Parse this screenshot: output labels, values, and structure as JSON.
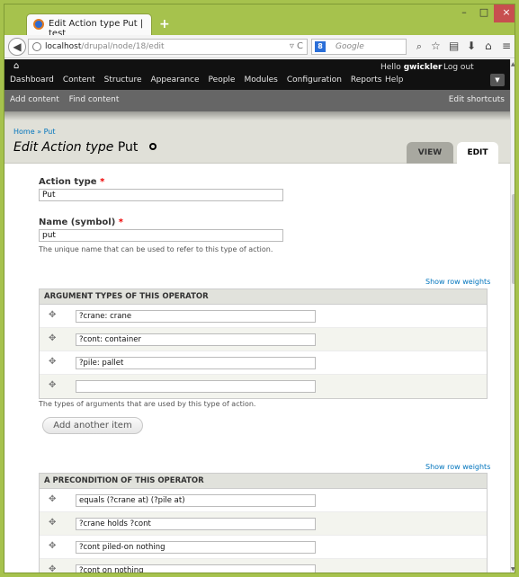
{
  "browser": {
    "tab_title": "Edit Action type Put | test",
    "new_tab": "+",
    "url_host": "localhost",
    "url_path": "/drupal/node/18/edit",
    "search_placeholder": "Google",
    "search_engine_letter": "8"
  },
  "toolbar": {
    "home_icon": "house-icon",
    "menu": [
      "Dashboard",
      "Content",
      "Structure",
      "Appearance",
      "People",
      "Modules",
      "Configuration",
      "Reports",
      "Help"
    ],
    "hello": "Hello",
    "username": "gwickler",
    "logout": "Log out"
  },
  "shortcuts": {
    "left": [
      "Add content",
      "Find content"
    ],
    "right": "Edit shortcuts"
  },
  "header": {
    "breadcrumb": "Home » Put",
    "title_italic": "Edit Action type",
    "title_name": "Put",
    "tabs": [
      "VIEW",
      "EDIT"
    ]
  },
  "form": {
    "action_type_label": "Action type",
    "action_type_value": "Put",
    "name_label": "Name (symbol)",
    "name_value": "put",
    "name_desc": "The unique name that can be used to refer to this type of action.",
    "required_marker": "*",
    "show_row_weights": "Show row weights",
    "arguments": {
      "header": "ARGUMENT TYPES OF THIS OPERATOR",
      "rows": [
        "?crane: crane",
        "?cont: container",
        "?pile: pallet",
        ""
      ],
      "desc": "The types of arguments that are used by this type of action."
    },
    "add_another": "Add another item",
    "preconditions": {
      "header": "A PRECONDITION OF THIS OPERATOR",
      "rows": [
        "equals (?crane at) (?pile at)",
        "?crane holds ?cont",
        "?cont piled-on nothing",
        "?cont on nothing"
      ]
    }
  },
  "window": {
    "minimize": "–",
    "maximize": "□",
    "close": "×"
  }
}
